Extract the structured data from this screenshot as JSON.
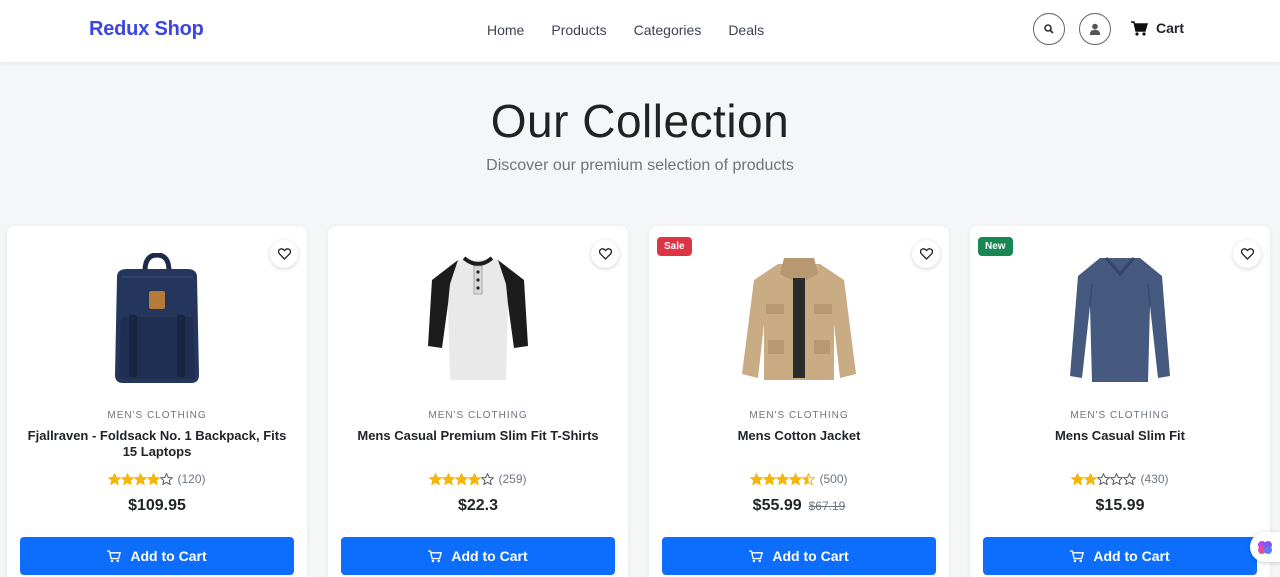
{
  "brand": "Redux Shop",
  "nav": [
    "Home",
    "Products",
    "Categories",
    "Deals"
  ],
  "icons": {
    "search": "search-icon",
    "user": "user-icon",
    "cart": "cart-icon"
  },
  "cart_label": "Cart",
  "hero": {
    "title": "Our Collection",
    "subtitle": "Discover our premium selection of products"
  },
  "colors": {
    "brand": "#3b46e0",
    "primary": "#0d6efd",
    "star": "#f5b50a",
    "sale": "#dc3545",
    "new": "#198754"
  },
  "products": [
    {
      "category": "MEN'S CLOTHING",
      "title": "Fjallraven - Foldsack No. 1 Backpack, Fits 15 Laptops",
      "rating": 3.9,
      "reviews": "(120)",
      "price": "$109.95",
      "old_price": "",
      "badge": "",
      "button": "Add to Cart"
    },
    {
      "category": "MEN'S CLOTHING",
      "title": "Mens Casual Premium Slim Fit T-Shirts",
      "rating": 4.1,
      "reviews": "(259)",
      "price": "$22.3",
      "old_price": "",
      "badge": "",
      "button": "Add to Cart"
    },
    {
      "category": "MEN'S CLOTHING",
      "title": "Mens Cotton Jacket",
      "rating": 4.7,
      "reviews": "(500)",
      "price": "$55.99",
      "old_price": "$67.19",
      "badge": "Sale",
      "button": "Add to Cart"
    },
    {
      "category": "MEN'S CLOTHING",
      "title": "Mens Casual Slim Fit",
      "rating": 2.1,
      "reviews": "(430)",
      "price": "$15.99",
      "old_price": "",
      "badge": "New",
      "button": "Add to Cart"
    }
  ]
}
